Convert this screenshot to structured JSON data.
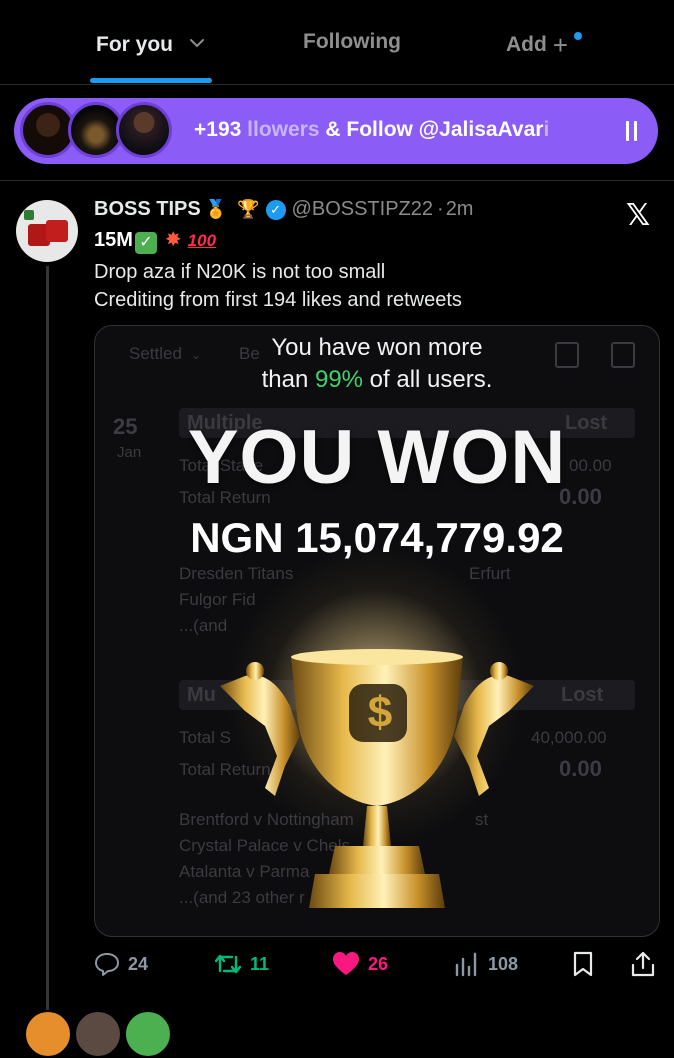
{
  "tabs": {
    "for_you": "For you",
    "following": "Following",
    "add": "Add"
  },
  "banner": {
    "count": "+193",
    "text_faded": "llowers",
    "text": " & Follow @JalisaAvar",
    "text_tail": "i"
  },
  "tweet": {
    "display_name": "BOSS TIPS",
    "emoji_medal": "🏅",
    "emoji_trophy": "🏆",
    "handle": "@BOSSTIPZ22",
    "separator": "·",
    "time": "2m",
    "line2_prefix": "15M",
    "line2_check": "✓",
    "line2_boom": "✸",
    "line2_hundred": "100",
    "body_line1": "Drop aza if N20K is not too small",
    "body_line2": "Crediting from first 194 likes and retweets"
  },
  "media": {
    "subtitle_line1": "You have won more",
    "subtitle_line2_pre": "than ",
    "subtitle_line2_pct": "99%",
    "subtitle_line2_post": " of all users.",
    "title": "YOU WON",
    "amount": "NGN 15,074,779.92",
    "logo_glyph": "$",
    "bg": {
      "settled": "Settled",
      "bet_prefix": "Be",
      "day": "25",
      "month": "Jan",
      "multiple": "Multiple",
      "lost": "Lost",
      "total_stake": "Total Stake",
      "total_return": "Total Return",
      "stake_val": "00.00",
      "return_val": "0.00",
      "line_a": "Dresden Titans",
      "line_a_tail": "Erfurt",
      "line_b": "Fulgor Fid",
      "line_c": "...(and",
      "mu": "Mu",
      "lost2": "Lost",
      "total_s2": "Total S",
      "stake2": "40,000.00",
      "total_r2": "Total Return",
      "return2": "0.00",
      "m1": "Brentford v Nottingham",
      "m1_tail": "st",
      "m2": "Crystal Palace v Chels",
      "m3": "Atalanta v Parma",
      "m4": "...(and 23 other r"
    }
  },
  "actions": {
    "replies": "24",
    "retweets": "11",
    "likes": "26",
    "views": "108"
  },
  "colors": {
    "accent": "#1d9bf0",
    "banner": "#8b5cf6",
    "retweet": "#00ba7c",
    "like": "#f91880",
    "win_green": "#3fd16b",
    "gold": "#d4a53a"
  },
  "icons": [
    "chevron-down-icon",
    "plus-icon",
    "pause-icon",
    "verified-icon",
    "x-logo-icon",
    "reply-icon",
    "retweet-icon",
    "heart-icon",
    "views-icon",
    "bookmark-icon",
    "share-icon",
    "calendar-icon",
    "trash-icon"
  ]
}
